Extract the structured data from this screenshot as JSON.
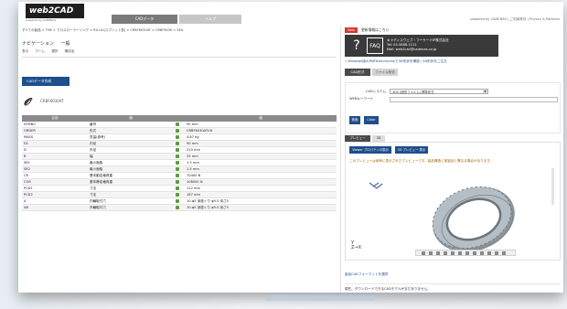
{
  "header": {
    "logo": "web2CAD",
    "logo_sub": "powered by CADENAS",
    "tabs": [
      {
        "label": "CADデータ",
        "active": true
      },
      {
        "label": "ヘルプ",
        "active": false
      }
    ],
    "right_text": "powered by CADENAS | ご利用条件 | Privacy & Partners"
  },
  "left": {
    "breadcrumb": "すべての製品 > THK > クロスローラーリング > RU-UU(スプリット型) > CRBF6030AT > CRBF6030 > SEA",
    "nav": [
      "ナビゲーション",
      "一般"
    ],
    "view_options": [
      "表示",
      "ホーム",
      "選択",
      "構成品"
    ],
    "cad_button": "CADデータ作成",
    "product_code": "CRBF6030AT",
    "table": {
      "headers": [
        "名前",
        "値",
        "",
        "値"
      ],
      "rows": [
        [
          "SYMBO",
          "番号",
          "90 mm"
        ],
        [
          "ORDER",
          "形式",
          "CRBF6030ATUU"
        ],
        [
          "MASS",
          "質量(参考)",
          "4.67 kg"
        ],
        [
          "D1",
          "内径",
          "90 mm"
        ],
        [
          "D",
          "外径",
          "210 mm"
        ],
        [
          "B",
          "幅",
          "25 mm"
        ],
        [
          "SR1",
          "最小面取",
          "1.5 mm"
        ],
        [
          "SR2",
          "最小面取",
          "1.5 mm"
        ],
        [
          "CR",
          "基本動定格荷重",
          "70400 N"
        ],
        [
          "COR",
          "基本静定格荷重",
          "108000 N"
        ],
        [
          "PCD1",
          "寸法",
          "112 mm"
        ],
        [
          "PCD2",
          "寸法",
          "187 mm"
        ],
        [
          "A",
          "内輪取付穴",
          "10-φ5 深座ぐり φ9.5 深さ5"
        ],
        [
          "AB",
          "外輪取付穴",
          "10-φ5 深座ぐり φ9.5 深さ5"
        ]
      ]
    }
  },
  "right": {
    "badge": "New",
    "title": "更新情報はこちら",
    "info_banner": {
      "q": "?",
      "faq": "FAQ",
      "lines": [
        "キャディスウェブ・フーケードIP株式会社",
        "Tel: 03-5888-1111",
        "Mail: web2cad@cadenas.co.jp"
      ]
    },
    "info_link": "» Windows版のPARTcommunityで3D形状を確認 / 3D形状をご注文",
    "tabs": [
      "CAD形式",
      "ファイル形式"
    ],
    "form": {
      "cad_label": "CADシステム",
      "cad_value": "3DS (固形フォルム) 標準形式",
      "keyword_label": "WEBキーワード",
      "search_button": "検索",
      "clear_button": "Clear"
    },
    "preview_tabs": [
      "プレビュー",
      "3D"
    ],
    "preview_buttons": [
      "Viewer プロパティの表示",
      "3D プレビュー 表示"
    ],
    "preview_note": "このプレビューは参考に表示されたプレビューです。製品構造と実製品と異なる場合があります。",
    "axis": [
      "Y",
      "Z→X"
    ],
    "download_link": "製品CADフォーマットを選択",
    "download_note": "現在、ダウンロードできるCADモデルがまだありません。"
  },
  "colors": {
    "accent": "#1e4e8c",
    "badge": "#d23a2a",
    "lock": "#5a9e3a",
    "header_gray": "#8a8a8a",
    "banner": "#3a3a3a"
  }
}
